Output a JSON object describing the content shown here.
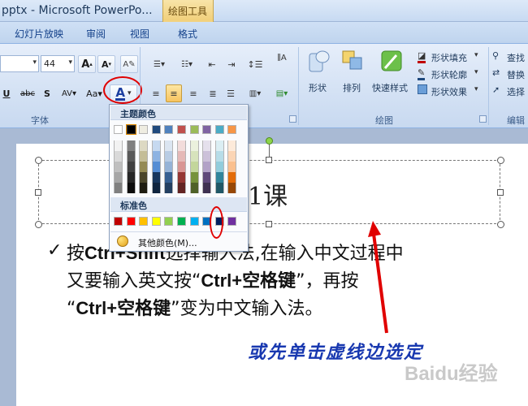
{
  "window": {
    "title": "pptx - Microsoft PowerPo..."
  },
  "context_tab_group": "绘图工具",
  "tabs": [
    "幻灯片放映",
    "审阅",
    "视图",
    "格式"
  ],
  "ribbon": {
    "font_size": "44",
    "font_group_label": "字体",
    "drawing_group_label": "绘图",
    "editing_group_label": "编辑",
    "shape_label": "形状",
    "arrange_label": "排列",
    "quick_styles_label": "快速样式",
    "shape_fill": "形状填充",
    "shape_outline": "形状轮廓",
    "shape_effects": "形状效果",
    "find": "查找",
    "replace": "替换",
    "select": "选择",
    "btn_grow": "A",
    "btn_shrink": "A",
    "btn_underline": "U",
    "btn_strike": "abc",
    "btn_shadow": "S",
    "btn_spacing": "AV",
    "btn_case": "Aa",
    "btn_fontcolor": "A"
  },
  "color_menu": {
    "theme_header": "主题颜色",
    "standard_header": "标准色",
    "more_colors": "其他颜色(M)...",
    "theme_colors": [
      "#ffffff",
      "#000000",
      "#eeece1",
      "#1f497d",
      "#4f81bd",
      "#c0504d",
      "#9bbb59",
      "#8064a2",
      "#4bacc6",
      "#f79646"
    ],
    "shade_columns": [
      [
        "#f2f2f2",
        "#d9d9d9",
        "#bfbfbf",
        "#a6a6a6",
        "#808080"
      ],
      [
        "#7f7f7f",
        "#595959",
        "#404040",
        "#262626",
        "#0d0d0d"
      ],
      [
        "#ddd9c3",
        "#c4bd97",
        "#948a54",
        "#4a452a",
        "#1e1c11"
      ],
      [
        "#c6d9f0",
        "#8db3e2",
        "#548dd4",
        "#17365d",
        "#0f243e"
      ],
      [
        "#dbe5f1",
        "#b8cce4",
        "#95b3d7",
        "#366092",
        "#244061"
      ],
      [
        "#f2dcdb",
        "#e5b9b7",
        "#d99694",
        "#953734",
        "#632423"
      ],
      [
        "#ebf1dd",
        "#d7e3bc",
        "#c3d69b",
        "#76923c",
        "#4f6128"
      ],
      [
        "#e5e0ec",
        "#ccc1d9",
        "#b2a2c7",
        "#5f497a",
        "#3f3151"
      ],
      [
        "#dbeef3",
        "#b7dde8",
        "#92cddc",
        "#31859b",
        "#205867"
      ],
      [
        "#fdeada",
        "#fbd5b5",
        "#fac08f",
        "#e36c09",
        "#974806"
      ]
    ],
    "standard_colors": [
      "#c00000",
      "#ff0000",
      "#ffc000",
      "#ffff00",
      "#92d050",
      "#00b050",
      "#00b0f0",
      "#0070c0",
      "#002060",
      "#7030a0"
    ],
    "selected_theme_index": 1,
    "highlighted_standard_index": 7
  },
  "slide": {
    "title": "第1课",
    "title_visible_part": "第1课",
    "line1_pre": "按",
    "line1_key": "Ctrl+Shift",
    "line1_post": "选择输入法,在输入中文过程中",
    "line2_pre": "又要输入英文按“",
    "line2_key": "Ctrl+空格键",
    "line2_post": "”，再按",
    "line3_pre": "“",
    "line3_key": "Ctrl+空格键",
    "line3_post": "”变为中文输入法。",
    "bullet": "✓",
    "annotation": "或先单击虚线边选定",
    "watermark": "Baidu经验"
  },
  "colors": {
    "annotation_blue": "#1838b0",
    "red_marker": "#e00000"
  }
}
